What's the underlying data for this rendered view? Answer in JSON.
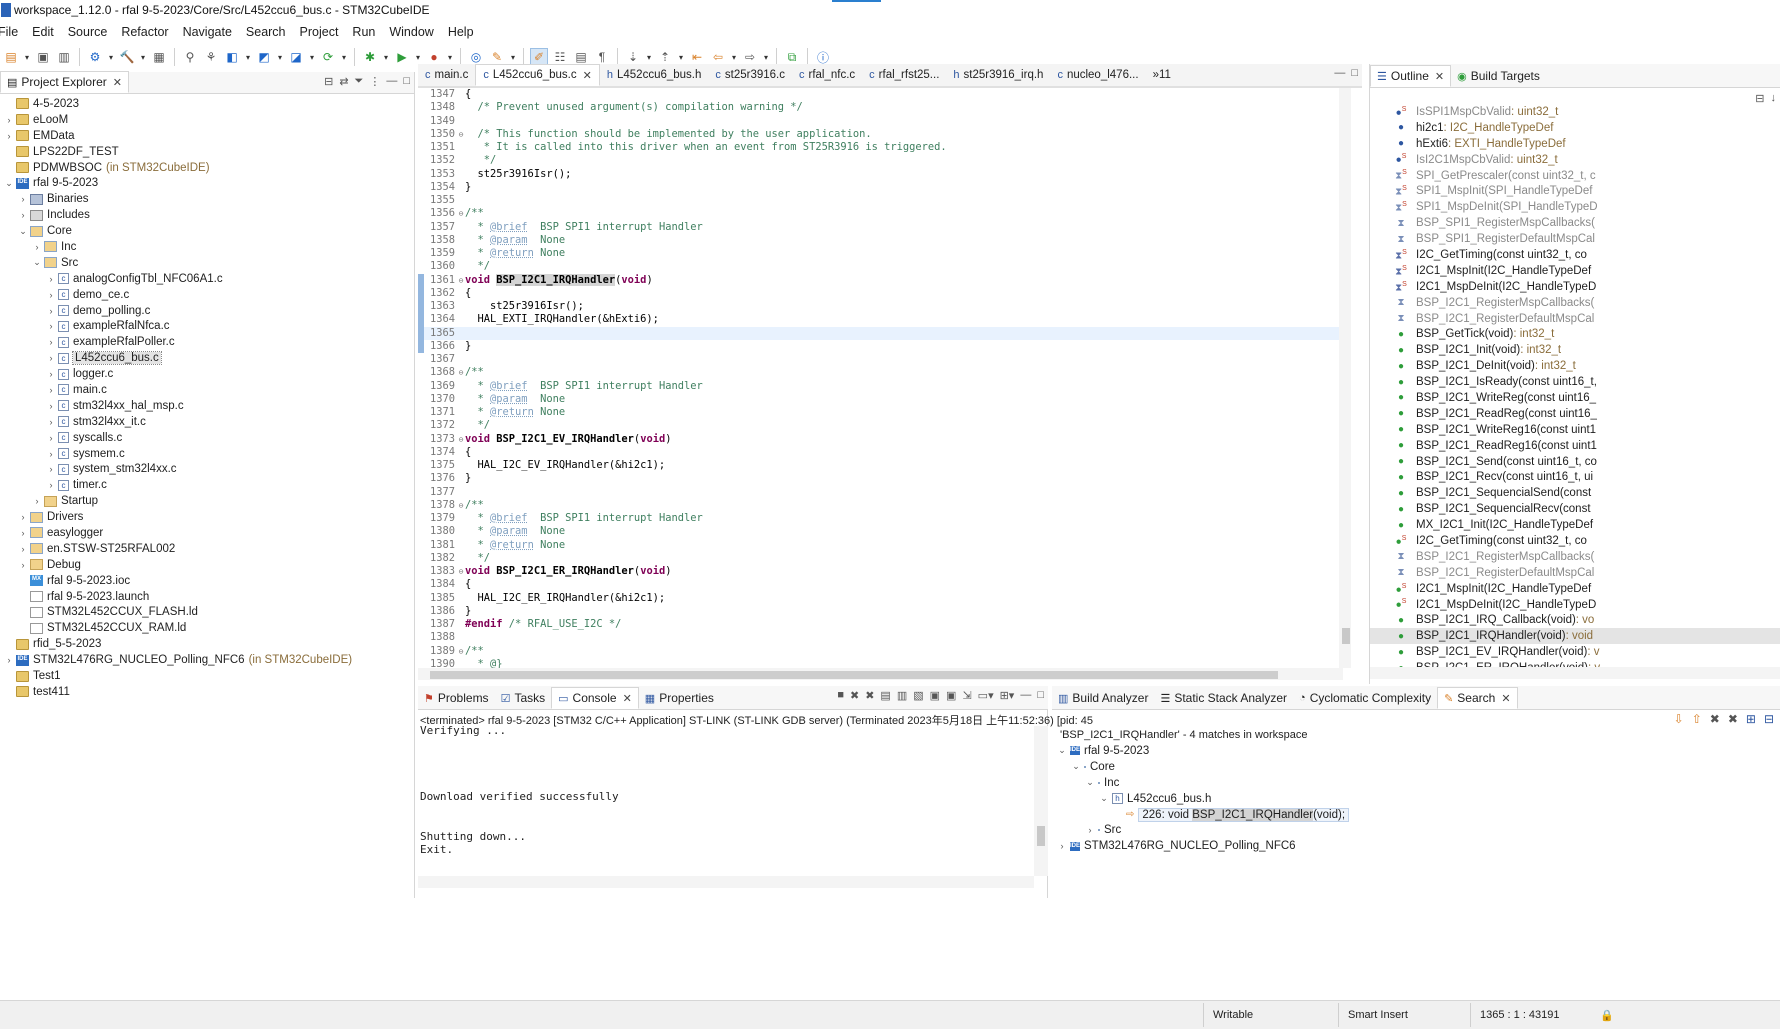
{
  "window": {
    "title": "workspace_1.12.0 - rfal 9-5-2023/Core/Src/L452ccu6_bus.c - STM32CubeIDE"
  },
  "menu": [
    "File",
    "Edit",
    "Source",
    "Refactor",
    "Navigate",
    "Search",
    "Project",
    "Run",
    "Window",
    "Help"
  ],
  "explorer": {
    "tab": "Project Explorer",
    "tree": [
      {
        "d": 0,
        "tw": "",
        "icon": "proj",
        "label": "4-5-2023"
      },
      {
        "d": 0,
        "tw": "›",
        "icon": "proj",
        "label": "eLooM"
      },
      {
        "d": 0,
        "tw": "›",
        "icon": "proj",
        "label": "EMData"
      },
      {
        "d": 0,
        "tw": "",
        "icon": "proj",
        "label": "LPS22DF_TEST"
      },
      {
        "d": 0,
        "tw": "",
        "icon": "proj",
        "label": "PDMWBSOC",
        "extra": "(in STM32CubeIDE)"
      },
      {
        "d": 0,
        "tw": "⌄",
        "icon": "ide",
        "label": "rfal 9-5-2023"
      },
      {
        "d": 1,
        "tw": "›",
        "icon": "bin",
        "label": "Binaries"
      },
      {
        "d": 1,
        "tw": "›",
        "icon": "inc",
        "label": "Includes"
      },
      {
        "d": 1,
        "tw": "⌄",
        "icon": "srcf",
        "label": "Core"
      },
      {
        "d": 2,
        "tw": "›",
        "icon": "srcf",
        "label": "Inc"
      },
      {
        "d": 2,
        "tw": "⌄",
        "icon": "srcf",
        "label": "Src"
      },
      {
        "d": 3,
        "tw": "›",
        "icon": "cfile",
        "label": "analogConfigTbl_NFC06A1.c"
      },
      {
        "d": 3,
        "tw": "›",
        "icon": "cfile",
        "label": "demo_ce.c"
      },
      {
        "d": 3,
        "tw": "›",
        "icon": "cfile",
        "label": "demo_polling.c"
      },
      {
        "d": 3,
        "tw": "›",
        "icon": "cfile",
        "label": "exampleRfalNfca.c"
      },
      {
        "d": 3,
        "tw": "›",
        "icon": "cfile",
        "label": "exampleRfalPoller.c"
      },
      {
        "d": 3,
        "tw": "›",
        "icon": "cfile",
        "label": "L452ccu6_bus.c",
        "sel": true
      },
      {
        "d": 3,
        "tw": "›",
        "icon": "cfile",
        "label": "logger.c"
      },
      {
        "d": 3,
        "tw": "›",
        "icon": "cfile",
        "label": "main.c"
      },
      {
        "d": 3,
        "tw": "›",
        "icon": "cfile",
        "label": "stm32l4xx_hal_msp.c"
      },
      {
        "d": 3,
        "tw": "›",
        "icon": "cfile",
        "label": "stm32l4xx_it.c"
      },
      {
        "d": 3,
        "tw": "›",
        "icon": "cfile",
        "label": "syscalls.c"
      },
      {
        "d": 3,
        "tw": "›",
        "icon": "cfile",
        "label": "sysmem.c"
      },
      {
        "d": 3,
        "tw": "›",
        "icon": "cfile",
        "label": "system_stm32l4xx.c"
      },
      {
        "d": 3,
        "tw": "›",
        "icon": "cfile",
        "label": "timer.c"
      },
      {
        "d": 2,
        "tw": "›",
        "icon": "folder",
        "label": "Startup"
      },
      {
        "d": 1,
        "tw": "›",
        "icon": "srcf",
        "label": "Drivers"
      },
      {
        "d": 1,
        "tw": "›",
        "icon": "srcf",
        "label": "easylogger"
      },
      {
        "d": 1,
        "tw": "›",
        "icon": "srcf",
        "label": "en.STSW-ST25RFAL002"
      },
      {
        "d": 1,
        "tw": "›",
        "icon": "folder",
        "label": "Debug"
      },
      {
        "d": 1,
        "tw": "",
        "icon": "mx",
        "label": "rfal 9-5-2023.ioc"
      },
      {
        "d": 1,
        "tw": "",
        "icon": "ld",
        "label": "rfal 9-5-2023.launch"
      },
      {
        "d": 1,
        "tw": "",
        "icon": "ld",
        "label": "STM32L452CCUX_FLASH.ld"
      },
      {
        "d": 1,
        "tw": "",
        "icon": "ld",
        "label": "STM32L452CCUX_RAM.ld"
      },
      {
        "d": 0,
        "tw": "",
        "icon": "proj",
        "label": "rfid_5-5-2023"
      },
      {
        "d": 0,
        "tw": "›",
        "icon": "ide",
        "label": "STM32L476RG_NUCLEO_Polling_NFC6",
        "extra": "(in STM32CubeIDE)"
      },
      {
        "d": 0,
        "tw": "",
        "icon": "proj",
        "label": "Test1"
      },
      {
        "d": 0,
        "tw": "",
        "icon": "proj",
        "label": "test411"
      }
    ]
  },
  "editor": {
    "tabs": [
      "main.c",
      "L452ccu6_bus.c",
      "L452ccu6_bus.h",
      "st25r3916.c",
      "rfal_nfc.c",
      "rfal_rfst25...",
      "st25r3916_irq.h",
      "nucleo_l476..."
    ],
    "overflow": "»11",
    "lines": [
      {
        "n": "1347",
        "f": "",
        "mark": false,
        "t": "{"
      },
      {
        "n": "1348",
        "f": "",
        "mark": false,
        "t": "  /* Prevent unused argument(s) compilation warning */",
        "cls": "com"
      },
      {
        "n": "1349",
        "f": "",
        "mark": false,
        "t": ""
      },
      {
        "n": "1350",
        "f": "⊖",
        "mark": false,
        "t": "  /* This function should be implemented by the user application.",
        "cls": "com"
      },
      {
        "n": "1351",
        "f": "",
        "mark": false,
        "t": "   * It is called into this driver when an event from ST25R3916 is triggered.",
        "cls": "com"
      },
      {
        "n": "1352",
        "f": "",
        "mark": false,
        "t": "   */",
        "cls": "com"
      },
      {
        "n": "1353",
        "f": "",
        "mark": false,
        "t": "  st25r3916Isr();"
      },
      {
        "n": "1354",
        "f": "",
        "mark": false,
        "t": "}"
      },
      {
        "n": "1355",
        "f": "",
        "mark": false,
        "t": ""
      },
      {
        "n": "1356",
        "f": "⊖",
        "mark": false,
        "t": "/**",
        "cls": "com"
      },
      {
        "n": "1357",
        "f": "",
        "mark": false,
        "t": "  * @brief  BSP SPI1 interrupt Handler",
        "cls": "com"
      },
      {
        "n": "1358",
        "f": "",
        "mark": false,
        "t": "  * @param  None",
        "cls": "com"
      },
      {
        "n": "1359",
        "f": "",
        "mark": false,
        "t": "  * @return None",
        "cls": "com"
      },
      {
        "n": "1360",
        "f": "",
        "mark": false,
        "t": "  */",
        "cls": "com"
      },
      {
        "n": "1361",
        "f": "⊖",
        "mark": true,
        "t": "void BSP_I2C1_IRQHandler(void)",
        "cls": "fn-hl"
      },
      {
        "n": "1362",
        "f": "",
        "mark": true,
        "t": "{"
      },
      {
        "n": "1363",
        "f": "",
        "mark": true,
        "t": "    st25r3916Isr();"
      },
      {
        "n": "1364",
        "f": "",
        "mark": true,
        "t": "  HAL_EXTI_IRQHandler(&hExti6);"
      },
      {
        "n": "1365",
        "f": "",
        "mark": true,
        "t": "",
        "cur": true
      },
      {
        "n": "1366",
        "f": "",
        "mark": true,
        "t": "}"
      },
      {
        "n": "1367",
        "f": "",
        "mark": false,
        "t": ""
      },
      {
        "n": "1368",
        "f": "⊖",
        "mark": false,
        "t": "/**",
        "cls": "com"
      },
      {
        "n": "1369",
        "f": "",
        "mark": false,
        "t": "  * @brief  BSP SPI1 interrupt Handler",
        "cls": "com"
      },
      {
        "n": "1370",
        "f": "",
        "mark": false,
        "t": "  * @param  None",
        "cls": "com"
      },
      {
        "n": "1371",
        "f": "",
        "mark": false,
        "t": "  * @return None",
        "cls": "com"
      },
      {
        "n": "1372",
        "f": "",
        "mark": false,
        "t": "  */",
        "cls": "com"
      },
      {
        "n": "1373",
        "f": "⊖",
        "mark": false,
        "t": "void BSP_I2C1_EV_IRQHandler(void)",
        "cls": "fn"
      },
      {
        "n": "1374",
        "f": "",
        "mark": false,
        "t": "{"
      },
      {
        "n": "1375",
        "f": "",
        "mark": false,
        "t": "  HAL_I2C_EV_IRQHandler(&hi2c1);"
      },
      {
        "n": "1376",
        "f": "",
        "mark": false,
        "t": "}"
      },
      {
        "n": "1377",
        "f": "",
        "mark": false,
        "t": ""
      },
      {
        "n": "1378",
        "f": "⊖",
        "mark": false,
        "t": "/**",
        "cls": "com"
      },
      {
        "n": "1379",
        "f": "",
        "mark": false,
        "t": "  * @brief  BSP SPI1 interrupt Handler",
        "cls": "com"
      },
      {
        "n": "1380",
        "f": "",
        "mark": false,
        "t": "  * @param  None",
        "cls": "com"
      },
      {
        "n": "1381",
        "f": "",
        "mark": false,
        "t": "  * @return None",
        "cls": "com"
      },
      {
        "n": "1382",
        "f": "",
        "mark": false,
        "t": "  */",
        "cls": "com"
      },
      {
        "n": "1383",
        "f": "⊖",
        "mark": false,
        "t": "void BSP_I2C1_ER_IRQHandler(void)",
        "cls": "fn"
      },
      {
        "n": "1384",
        "f": "",
        "mark": false,
        "t": "{"
      },
      {
        "n": "1385",
        "f": "",
        "mark": false,
        "t": "  HAL_I2C_ER_IRQHandler(&hi2c1);"
      },
      {
        "n": "1386",
        "f": "",
        "mark": false,
        "t": "}"
      },
      {
        "n": "1387",
        "f": "",
        "mark": false,
        "t": "#endif /* RFAL_USE_I2C */",
        "cls": "pp"
      },
      {
        "n": "1388",
        "f": "",
        "mark": false,
        "t": ""
      },
      {
        "n": "1389",
        "f": "⊖",
        "mark": false,
        "t": "/**",
        "cls": "com"
      },
      {
        "n": "1390",
        "f": "",
        "mark": false,
        "t": "  * @}",
        "cls": "com"
      }
    ]
  },
  "outline": {
    "tabs": [
      "Outline",
      "Build Targets"
    ],
    "items": [
      {
        "i": "fld",
        "s": "S",
        "name": "IsSPI1MspCbValid",
        "type": " : uint32_t",
        "gray": true
      },
      {
        "i": "fld",
        "s": "",
        "name": "hi2c1",
        "type": " : I2C_HandleTypeDef"
      },
      {
        "i": "fld",
        "s": "",
        "name": "hExti6",
        "type": " : EXTI_HandleTypeDef"
      },
      {
        "i": "fld",
        "s": "S",
        "name": "IsI2C1MspCbValid",
        "type": " : uint32_t",
        "gray": true
      },
      {
        "i": "grey",
        "s": "S",
        "name": "SPI_GetPrescaler(const uint32_t, c",
        "type": "",
        "gray": true
      },
      {
        "i": "grey",
        "s": "S",
        "name": "SPI1_MspInit(SPI_HandleTypeDef",
        "type": "",
        "gray": true
      },
      {
        "i": "grey",
        "s": "S",
        "name": "SPI1_MspDeInit(SPI_HandleTypeD",
        "type": "",
        "gray": true
      },
      {
        "i": "grey",
        "s": "",
        "name": "BSP_SPI1_RegisterMspCallbacks(",
        "type": "",
        "gray": true
      },
      {
        "i": "grey",
        "s": "",
        "name": "BSP_SPI1_RegisterDefaultMspCal",
        "type": "",
        "gray": true
      },
      {
        "i": "priv",
        "s": "S",
        "name": "I2C_GetTiming(const uint32_t, co",
        "type": ""
      },
      {
        "i": "priv",
        "s": "S",
        "name": "I2C1_MspInit(I2C_HandleTypeDef",
        "type": ""
      },
      {
        "i": "priv",
        "s": "S",
        "name": "I2C1_MspDeInit(I2C_HandleTypeD",
        "type": ""
      },
      {
        "i": "grey",
        "s": "",
        "name": "BSP_I2C1_RegisterMspCallbacks(",
        "type": "",
        "gray": true
      },
      {
        "i": "grey",
        "s": "",
        "name": "BSP_I2C1_RegisterDefaultMspCal",
        "type": "",
        "gray": true
      },
      {
        "i": "pub",
        "s": "",
        "name": "BSP_GetTick(void)",
        "type": " : int32_t"
      },
      {
        "i": "pub",
        "s": "",
        "name": "BSP_I2C1_Init(void)",
        "type": " : int32_t"
      },
      {
        "i": "pub",
        "s": "",
        "name": "BSP_I2C1_DeInit(void)",
        "type": " : int32_t"
      },
      {
        "i": "pub",
        "s": "",
        "name": "BSP_I2C1_IsReady(const uint16_t,",
        "type": ""
      },
      {
        "i": "pub",
        "s": "",
        "name": "BSP_I2C1_WriteReg(const uint16_",
        "type": ""
      },
      {
        "i": "pub",
        "s": "",
        "name": "BSP_I2C1_ReadReg(const uint16_",
        "type": ""
      },
      {
        "i": "pub",
        "s": "",
        "name": "BSP_I2C1_WriteReg16(const uint1",
        "type": ""
      },
      {
        "i": "pub",
        "s": "",
        "name": "BSP_I2C1_ReadReg16(const uint1",
        "type": ""
      },
      {
        "i": "pub",
        "s": "",
        "name": "BSP_I2C1_Send(const uint16_t, co",
        "type": ""
      },
      {
        "i": "pub",
        "s": "",
        "name": "BSP_I2C1_Recv(const uint16_t, ui",
        "type": ""
      },
      {
        "i": "pub",
        "s": "",
        "name": "BSP_I2C1_SequencialSend(const",
        "type": ""
      },
      {
        "i": "pub",
        "s": "",
        "name": "BSP_I2C1_SequencialRecv(const",
        "type": ""
      },
      {
        "i": "pub",
        "s": "",
        "name": "MX_I2C1_Init(I2C_HandleTypeDef",
        "type": ""
      },
      {
        "i": "pub",
        "s": "S",
        "name": "I2C_GetTiming(const uint32_t, co",
        "type": ""
      },
      {
        "i": "grey",
        "s": "",
        "name": "BSP_I2C1_RegisterMspCallbacks(",
        "type": "",
        "gray": true
      },
      {
        "i": "grey",
        "s": "",
        "name": "BSP_I2C1_RegisterDefaultMspCal",
        "type": "",
        "gray": true
      },
      {
        "i": "pub",
        "s": "S",
        "name": "I2C1_MspInit(I2C_HandleTypeDef",
        "type": ""
      },
      {
        "i": "pub",
        "s": "S",
        "name": "I2C1_MspDeInit(I2C_HandleTypeD",
        "type": ""
      },
      {
        "i": "pub",
        "s": "",
        "name": "BSP_I2C1_IRQ_Callback(void)",
        "type": " : vo"
      },
      {
        "i": "pub",
        "s": "",
        "name": "BSP_I2C1_IRQHandler(void)",
        "type": " : void",
        "sel": true
      },
      {
        "i": "pub",
        "s": "",
        "name": "BSP_I2C1_EV_IRQHandler(void)",
        "type": " : v"
      },
      {
        "i": "pub",
        "s": "",
        "name": "BSP_I2C1_ER_IRQHandler(void)",
        "type": " : v"
      }
    ]
  },
  "console": {
    "tabs": [
      "Problems",
      "Tasks",
      "Console",
      "Properties"
    ],
    "status": "<terminated> rfal 9-5-2023 [STM32 C/C++ Application] ST-LINK (ST-LINK GDB server) (Terminated 2023年5月18日 上午11:52:36) [pid: 45",
    "text": "Verifying ...\n\n\n\n\nDownload verified successfully\n\n\nShutting down...\nExit."
  },
  "search": {
    "tabs": [
      "Build Analyzer",
      "Static Stack Analyzer",
      "Cyclomatic Complexity",
      "Search"
    ],
    "summary": "'BSP_I2C1_IRQHandler' - 4 matches in workspace",
    "tree": [
      {
        "d": 0,
        "tw": "⌄",
        "icon": "ide",
        "label": "rfal 9-5-2023"
      },
      {
        "d": 1,
        "tw": "⌄",
        "icon": "srcf",
        "label": "Core"
      },
      {
        "d": 2,
        "tw": "⌄",
        "icon": "srcf",
        "label": "Inc"
      },
      {
        "d": 3,
        "tw": "⌄",
        "icon": "cfile",
        "label": "L452ccu6_bus.h"
      },
      {
        "d": 4,
        "tw": "",
        "icon": "match",
        "label": "226: void ",
        "hl": "BSP_I2C1_IRQHandler",
        "rest": "(void);"
      },
      {
        "d": 2,
        "tw": "›",
        "icon": "srcf",
        "label": "Src"
      },
      {
        "d": 0,
        "tw": "›",
        "icon": "ide",
        "label": "STM32L476RG_NUCLEO_Polling_NFC6"
      }
    ]
  },
  "statusbar": {
    "writable": "Writable",
    "insert": "Smart Insert",
    "position": "1365 : 1 : 43191"
  }
}
